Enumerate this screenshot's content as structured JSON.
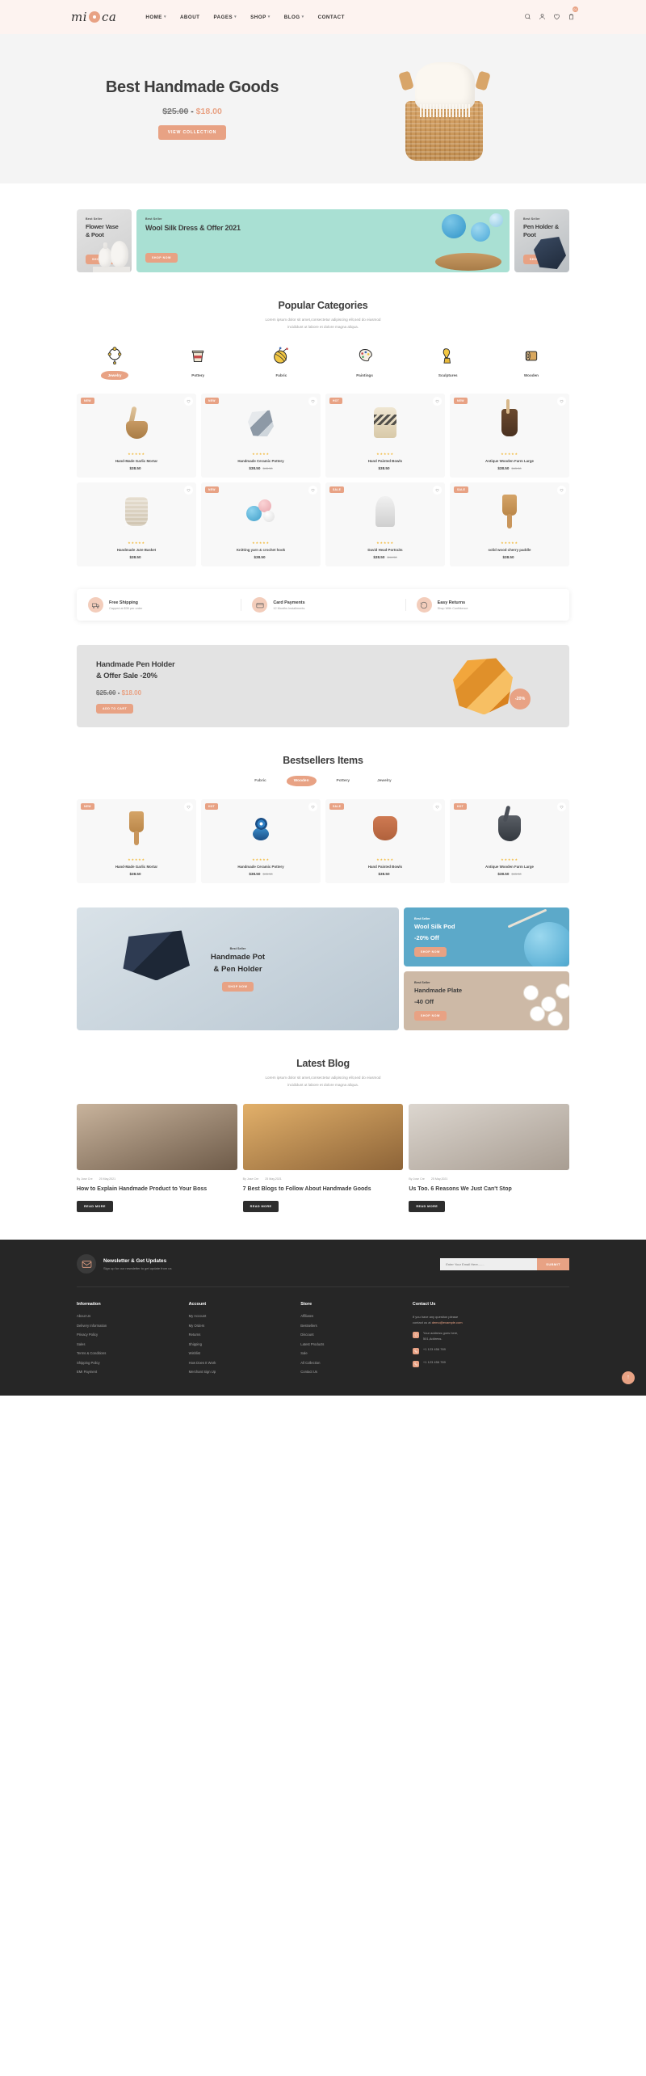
{
  "header": {
    "logo": "mi ca",
    "nav": [
      {
        "label": "HOME",
        "caret": "⌄"
      },
      {
        "label": "ABOUT",
        "caret": ""
      },
      {
        "label": "PAGES",
        "caret": "⌄"
      },
      {
        "label": "SHOP",
        "caret": "⌄"
      },
      {
        "label": "BLOG",
        "caret": "⌄"
      },
      {
        "label": "CONTACT",
        "caret": ""
      }
    ],
    "cart_count": "01"
  },
  "hero": {
    "title": "Best Handmade Goods",
    "old_price": "$25.00",
    "dash": "-",
    "new_price": "$18.00",
    "cta": "VIEW COLLECTION"
  },
  "promo_cards": [
    {
      "tag": "Best Seller",
      "title": "Flower Vase & Poot",
      "cta": "SHOP NOW"
    },
    {
      "tag": "Best Seller",
      "title": "Wool Silk Dress & Offer 2021",
      "cta": "SHOP NOW"
    },
    {
      "tag": "Best Seller",
      "title": "Pen Holder & Poot",
      "cta": "SHOP NOW"
    }
  ],
  "categories_section": {
    "title": "Popular Categories",
    "subtitle_line1": "Lorem ipsum dolor sit amet,consectetur adipiscing elit,sed do eiusmod",
    "subtitle_line2": "incididunt ut labore et dolore magna aliqua.",
    "items": [
      {
        "label": "Jewelry",
        "icon": "necklace-icon",
        "active": true
      },
      {
        "label": "Pottery",
        "icon": "pot-icon",
        "active": false
      },
      {
        "label": "Fabric",
        "icon": "yarn-ball-icon",
        "active": false
      },
      {
        "label": "Paintings",
        "icon": "palette-icon",
        "active": false
      },
      {
        "label": "Sculptures",
        "icon": "sculpture-icon",
        "active": false
      },
      {
        "label": "Wooden",
        "icon": "wood-log-icon",
        "active": false
      }
    ]
  },
  "products": [
    {
      "badge": "NEW",
      "badge_type": "new",
      "stars": "★★★★★",
      "name": "Hand-Made Garlic Mortar",
      "price": "$38.50",
      "old_price": "",
      "art": "mortar"
    },
    {
      "badge": "NEW",
      "badge_type": "new",
      "stars": "★★★★★",
      "name": "Handmade Ceramic Pottery",
      "price": "$38.50",
      "old_price": "$45.50",
      "art": "geo"
    },
    {
      "badge": "HOT",
      "badge_type": "hot",
      "stars": "★★★★★",
      "name": "Hand Painted Bowls",
      "price": "$38.50",
      "old_price": "",
      "art": "drum"
    },
    {
      "badge": "NEW",
      "badge_type": "new",
      "stars": "★★★★★",
      "name": "Antique Wooden Farm Large",
      "price": "$38.50",
      "old_price": "$45.50",
      "art": "cup"
    },
    {
      "badge": "",
      "badge_type": "",
      "stars": "★★★★★",
      "name": "Handmade Jute Basket",
      "price": "$38.50",
      "old_price": "",
      "art": "jute"
    },
    {
      "badge": "NEW",
      "badge_type": "new",
      "stars": "★★★★★",
      "name": "Knitting yarn & crochet hook",
      "price": "$38.50",
      "old_price": "",
      "art": "yarns"
    },
    {
      "badge": "SALE",
      "badge_type": "sale",
      "stars": "★★★★★",
      "name": "David Head Portraits",
      "price": "$38.50",
      "old_price": "$44.50",
      "art": "bust"
    },
    {
      "badge": "SALE",
      "badge_type": "sale",
      "stars": "★★★★★",
      "name": "solid wood cherry paddle",
      "price": "$38.50",
      "old_price": "",
      "art": "paddle"
    }
  ],
  "services": [
    {
      "title": "Free Shipping",
      "sub": "Capped at $39 per order",
      "icon": "truck-icon"
    },
    {
      "title": "Card Payments",
      "sub": "12 Months Installments",
      "icon": "card-icon"
    },
    {
      "title": "Easy Returns",
      "sub": "Shop With Confidence",
      "icon": "return-icon"
    }
  ],
  "big_promo": {
    "title_line1": "Handmade Pen Holder",
    "title_line2": "& Offer Sale -20%",
    "old_price": "$25.00",
    "dash": "-",
    "new_price": "$18.00",
    "cta": "ADD TO CART",
    "discount_badge": "-20%"
  },
  "bestsellers": {
    "title": "Bestsellers Items",
    "tabs": [
      {
        "label": "Fabric",
        "active": false
      },
      {
        "label": "Wooden",
        "active": true
      },
      {
        "label": "Pottery",
        "active": false
      },
      {
        "label": "Jewelry",
        "active": false
      }
    ],
    "products": [
      {
        "badge": "NEW",
        "badge_type": "new",
        "stars": "★★★★★",
        "name": "Hand-Made Garlic Mortar",
        "price": "$38.50",
        "old_price": "",
        "art": "paddle"
      },
      {
        "badge": "HOT",
        "badge_type": "hot",
        "stars": "★★★★★",
        "name": "Handmade Ceramic Pottery",
        "price": "$38.50",
        "old_price": "$45.50",
        "art": "evil"
      },
      {
        "badge": "SALE",
        "badge_type": "sale",
        "stars": "★★★★★",
        "name": "Hand Painted Bowls",
        "price": "$38.50",
        "old_price": "",
        "art": "pot"
      },
      {
        "badge": "HOT",
        "badge_type": "hot",
        "stars": "★★★★★",
        "name": "Antique Wooden Farm Large",
        "price": "$38.50",
        "old_price": "$45.50",
        "art": "mortar2"
      }
    ]
  },
  "dual_banner": {
    "left": {
      "tag": "Best Seller",
      "title_line1": "Handmade Pot",
      "title_line2": "& Pen Holder",
      "cta": "SHOP NOW"
    },
    "right_top": {
      "tag": "Best Seller",
      "title_line1": "Wool Silk Pod",
      "title_line2": "-20% Off",
      "cta": "SHOP NOW"
    },
    "right_bottom": {
      "tag": "Best Seller",
      "title_line1": "Handmade Plate",
      "title_line2": "-40 Off",
      "cta": "SHOP NOW"
    }
  },
  "blog_section": {
    "title": "Latest Blog",
    "subtitle_line1": "Lorem ipsum dolor sit amet,consectetur adipiscing elit,sed do eiusmod",
    "subtitle_line2": "incididunt ut labore et dolore magna aliqua.",
    "posts": [
      {
        "author": "By Jose Cre",
        "date": "25 May,2021",
        "title": "How to Explain Handmade Product to Your Boss",
        "cta": "READ MORE"
      },
      {
        "author": "By Jose Cre",
        "date": "25 May,2021",
        "title": "7 Best Blogs to Follow About Handmade Goods",
        "cta": "READ MORE"
      },
      {
        "author": "By Jose Cre",
        "date": "25 May,2021",
        "title": "Us Too. 6 Reasons We Just Can't Stop",
        "cta": "READ MORE"
      }
    ]
  },
  "newsletter": {
    "title": "Newsletter & Get Updates",
    "subtitle": "Sign up for our newsletter to get update from us",
    "placeholder": "Enter Your Email Here.......",
    "button": "SUBMIT",
    "icon": "envelope-icon"
  },
  "footer": {
    "columns": [
      {
        "heading": "Information",
        "links": [
          "About Us",
          "Delivery Information",
          "Privacy Policy",
          "Sales",
          "Terms & Conditions",
          "Shipping Policy",
          "EMI Payment"
        ]
      },
      {
        "heading": "Account",
        "links": [
          "My Account",
          "My Orders",
          "Returns",
          "Shipping",
          "Wishlist",
          "How Does It Work",
          "Merchant Sign Up"
        ]
      },
      {
        "heading": "Store",
        "links": [
          "Affiliates",
          "Bestsellers",
          "Discount",
          "Latest Products",
          "Sale",
          "All Collection",
          "Contact Us"
        ]
      }
    ],
    "contact": {
      "heading": "Contact Us",
      "intro_line1": "If you have any question please",
      "intro_line2_pre": "contact us at ",
      "intro_email": "demo@example.com",
      "address_label": "Your address goes here,",
      "address_value": "501,Address.",
      "phone": "+1 123 456 789",
      "phone2": "+1 123 456 789",
      "phone_icon": "phone-icon",
      "pin_icon": "location-pin-icon"
    },
    "to_top": "↑"
  }
}
